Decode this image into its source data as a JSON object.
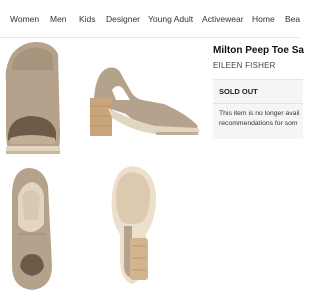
{
  "nav": {
    "items": [
      "Women",
      "Men",
      "Kids",
      "Designer",
      "Young Adult",
      "Activewear",
      "Home",
      "Beau"
    ]
  },
  "product": {
    "title": "Milton Peep Toe Sa",
    "brand": "EILEEN FISHER"
  },
  "availability": {
    "status": "SOLD OUT",
    "message_line1": "This item is no longer avail",
    "message_line2": "recommendations for som"
  },
  "gallery": {
    "images": [
      "shoe-front-view",
      "shoe-side-view",
      "shoe-top-view",
      "shoe-sole-view"
    ]
  },
  "colors": {
    "suede": "#b5a28d",
    "heel": "#c9a57c",
    "sole": "#e2d6c3",
    "panel": "#f3f5f7"
  }
}
